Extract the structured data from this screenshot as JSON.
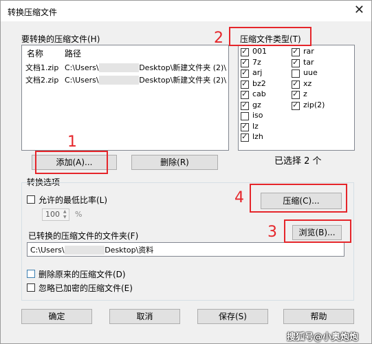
{
  "window": {
    "title": "转换压缩文件"
  },
  "files": {
    "label": "要转换的压缩文件(H)",
    "columns": [
      "名称",
      "路径"
    ],
    "rows": [
      {
        "name": "文档1.zip",
        "path_prefix": "C:\\Users\\",
        "path_hidden": "xxxxxxxxx",
        "path_suffix": "Desktop\\新建文件夹 (2)\\"
      },
      {
        "name": "文档2.zip",
        "path_prefix": "C:\\Users\\",
        "path_hidden": "xxxxxxxxx",
        "path_suffix": "Desktop\\新建文件夹 (2)\\"
      }
    ]
  },
  "types": {
    "label": "压缩文件类型(T)",
    "left": [
      {
        "name": "001",
        "checked": true
      },
      {
        "name": "7z",
        "checked": true
      },
      {
        "name": "arj",
        "checked": true
      },
      {
        "name": "bz2",
        "checked": true
      },
      {
        "name": "cab",
        "checked": true
      },
      {
        "name": "gz",
        "checked": true
      },
      {
        "name": "iso",
        "checked": false
      },
      {
        "name": "lz",
        "checked": true
      },
      {
        "name": "lzh",
        "checked": true
      }
    ],
    "right": [
      {
        "name": "rar",
        "checked": true
      },
      {
        "name": "tar",
        "checked": true
      },
      {
        "name": "uue",
        "checked": false
      },
      {
        "name": "xz",
        "checked": true
      },
      {
        "name": "z",
        "checked": true
      },
      {
        "name": "zip(2)",
        "checked": true
      }
    ],
    "selected_count": "已选择 2 个"
  },
  "buttons": {
    "add": "添加(A)...",
    "delete": "删除(R)",
    "compress": "压缩(C)...",
    "browse": "浏览(B)...",
    "ok": "确定",
    "cancel": "取消",
    "save": "保存(S)",
    "help": "帮助"
  },
  "options": {
    "group_label": "转换选项",
    "min_ratio_label": "允许的最低比率(L)",
    "min_ratio_checked": false,
    "ratio_value": "100",
    "ratio_unit": "%",
    "dest_label": "已转换的压缩文件的文件夹(F)",
    "dest_prefix": "C:\\Users\\",
    "dest_hidden": "xxxxxxxxx",
    "dest_suffix": "Desktop\\资料",
    "delete_original_label": "删除原来的压缩文件(D)",
    "delete_original_checked": false,
    "ignore_encrypted_label": "忽略已加密的压缩文件(E)",
    "ignore_encrypted_checked": false
  },
  "markers": [
    "1",
    "2",
    "3",
    "4"
  ],
  "watermark": "搜狐号@小奥炮炮",
  "colors": {
    "marker": "#e5252a",
    "dialog_bg": "#f0f0f0"
  }
}
